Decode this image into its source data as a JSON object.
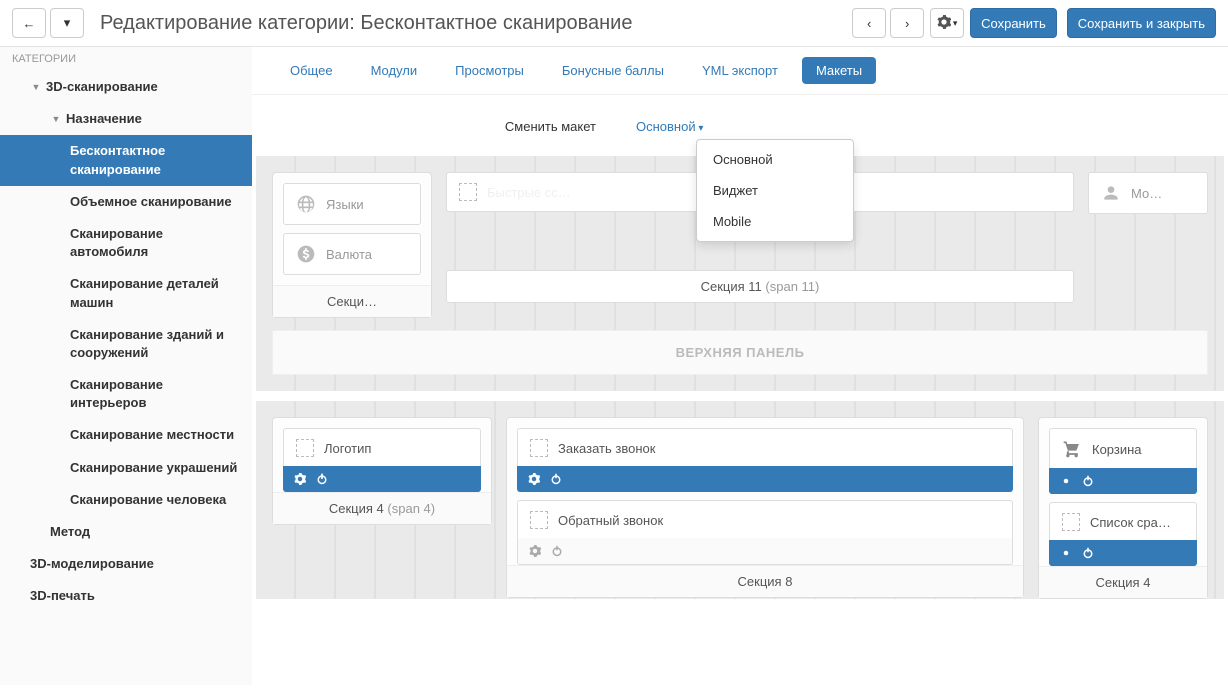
{
  "header": {
    "title": "Редактирование категории: Бесконтактное сканирование",
    "save": "Сохранить",
    "save_close": "Сохранить и закрыть"
  },
  "sidebar": {
    "header": "КАТЕГОРИИ",
    "root": "3D-сканирование",
    "sub1": "Назначение",
    "items": [
      "Бесконтактное сканирование",
      "Объемное сканирование",
      "Сканирование автомобиля",
      "Сканирование деталей машин",
      "Сканирование зданий и сооружений",
      "Сканирование интерьеров",
      "Сканирование местности",
      "Сканирование украшений",
      "Сканирование человека"
    ],
    "sub2": "Метод",
    "sibling1": "3D-моделирование",
    "sibling2": "3D-печать"
  },
  "tabs": [
    "Общее",
    "Модули",
    "Просмотры",
    "Бонусные баллы",
    "YML экспорт",
    "Макеты"
  ],
  "layout": {
    "label": "Сменить макет",
    "selected": "Основной",
    "options": [
      "Основной",
      "Виджет",
      "Mobile"
    ]
  },
  "top_panel": {
    "widgets_left": [
      "Языки",
      "Валюта"
    ],
    "section_left_label": "Секци…",
    "section11_label": "Секция 11",
    "section11_span": "(span 11)",
    "widget_right": "Мо…",
    "title": "ВЕРХНЯЯ ПАНЕЛЬ"
  },
  "middle": {
    "section4": {
      "widget": "Логотип",
      "label": "Секция 4",
      "span": "(span 4)"
    },
    "section8": {
      "widgets": [
        "Заказать звонок",
        "Обратный звонок"
      ],
      "label": "Секция 8"
    },
    "section4b": {
      "widgets": [
        "Корзина",
        "Список сра…"
      ],
      "label": "Секция 4"
    }
  }
}
